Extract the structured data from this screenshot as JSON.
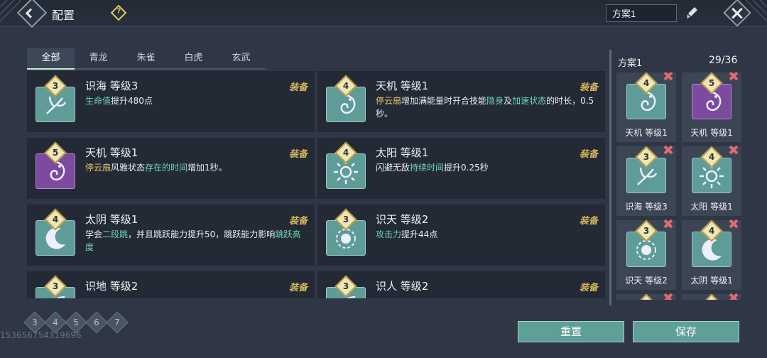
{
  "header": {
    "title": "配置",
    "help_glyph": "?",
    "plan_name": "方案1"
  },
  "tabs": [
    {
      "label": "全部",
      "active": true
    },
    {
      "label": "青龙",
      "active": false
    },
    {
      "label": "朱雀",
      "active": false
    },
    {
      "label": "白虎",
      "active": false
    },
    {
      "label": "玄武",
      "active": false
    }
  ],
  "equip_label": "装备",
  "cards": [
    {
      "name": "识海 等级3",
      "level": "3",
      "color": "teal",
      "icon": "branch-icon",
      "desc": [
        {
          "t": "生命值",
          "c": "g"
        },
        {
          "t": "提升480点",
          "c": ""
        }
      ]
    },
    {
      "name": "天机 等级1",
      "level": "4",
      "color": "teal",
      "icon": "dragon-icon",
      "desc": [
        {
          "t": "停云扇",
          "c": "y"
        },
        {
          "t": "增加满能量时开合技能",
          "c": ""
        },
        {
          "t": "隐身",
          "c": "g"
        },
        {
          "t": "及",
          "c": ""
        },
        {
          "t": "加速状态",
          "c": "g"
        },
        {
          "t": "的时长，0.5秒。",
          "c": ""
        }
      ]
    },
    {
      "name": "天机 等级1",
      "level": "5",
      "color": "purple",
      "icon": "dragon-icon",
      "desc": [
        {
          "t": "停云扇",
          "c": "y"
        },
        {
          "t": "风雅状态",
          "c": ""
        },
        {
          "t": "存在的时间",
          "c": "g"
        },
        {
          "t": "增加1秒。",
          "c": ""
        }
      ]
    },
    {
      "name": "太阳 等级1",
      "level": "4",
      "color": "teal",
      "icon": "sun-icon",
      "desc": [
        {
          "t": "闪避无敌",
          "c": ""
        },
        {
          "t": "持续时间",
          "c": "g"
        },
        {
          "t": "提升0.25秒",
          "c": ""
        }
      ]
    },
    {
      "name": "太阴 等级1",
      "level": "4",
      "color": "teal",
      "icon": "moon-icon",
      "desc": [
        {
          "t": "学会",
          "c": ""
        },
        {
          "t": "二段跳",
          "c": "g"
        },
        {
          "t": "，并且跳跃能力提升50，跳跃能力影响",
          "c": ""
        },
        {
          "t": "跳跃高度",
          "c": "g"
        }
      ]
    },
    {
      "name": "识天 等级2",
      "level": "3",
      "color": "teal",
      "icon": "orb-icon",
      "desc": [
        {
          "t": "攻击力",
          "c": "g"
        },
        {
          "t": "提升44点",
          "c": ""
        }
      ]
    },
    {
      "name": "识地 等级2",
      "level": "3",
      "color": "teal",
      "icon": "leaf-icon",
      "desc": []
    },
    {
      "name": "识人 等级2",
      "level": "3",
      "color": "teal",
      "icon": "leaf-icon",
      "desc": []
    }
  ],
  "panel": {
    "title": "方案1",
    "count": "29/36",
    "slots": [
      {
        "name": "天机 等级1",
        "level": "4",
        "color": "teal",
        "icon": "dragon-icon"
      },
      {
        "name": "天机 等级1",
        "level": "5",
        "color": "purple",
        "icon": "dragon-icon"
      },
      {
        "name": "识海 等级3",
        "level": "3",
        "color": "teal",
        "icon": "branch-icon"
      },
      {
        "name": "太阳 等级1",
        "level": "4",
        "color": "teal",
        "icon": "sun-icon"
      },
      {
        "name": "识天 等级2",
        "level": "3",
        "color": "teal",
        "icon": "orb-icon"
      },
      {
        "name": "太阴 等级1",
        "level": "4",
        "color": "teal",
        "icon": "moon-icon"
      },
      {
        "name": "",
        "level": "",
        "color": "teal",
        "icon": "leaf-icon"
      },
      {
        "name": "",
        "level": "",
        "color": "teal",
        "icon": "leaf-icon"
      }
    ]
  },
  "filters": [
    "3",
    "4",
    "5",
    "6",
    "7"
  ],
  "watermark": "153656754319696",
  "buttons": {
    "reset": "重置",
    "save": "保存"
  },
  "colors": {
    "teal_tile": "#5f9c98",
    "purple_tile": "#7c4a9e",
    "gold": "#d6b85a",
    "highlight_green": "#6fd6b4",
    "highlight_yellow": "#e8c463"
  }
}
